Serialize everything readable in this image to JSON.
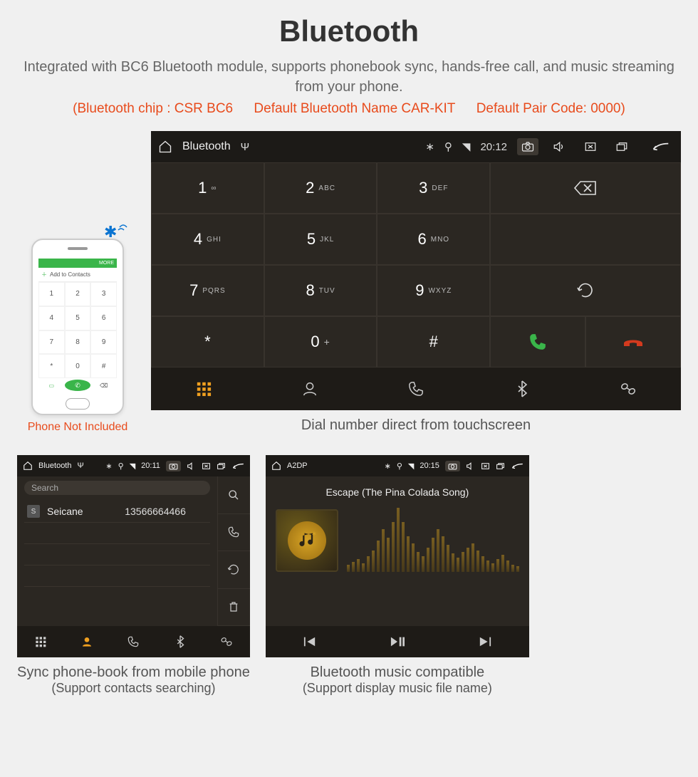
{
  "header": {
    "title": "Bluetooth",
    "description": "Integrated with BC6 Bluetooth module, supports phonebook sync, hands-free call, and music streaming from your phone.",
    "spec_chip": "(Bluetooth chip : CSR BC6",
    "spec_name": "Default Bluetooth Name CAR-KIT",
    "spec_pair": "Default Pair Code: 0000)"
  },
  "phone": {
    "top_more": "MORE",
    "add_contacts": "Add to Contacts",
    "keys": [
      "1",
      "2",
      "3",
      "4",
      "5",
      "6",
      "7",
      "8",
      "9",
      "*",
      "0",
      "#"
    ],
    "note": "Phone Not Included"
  },
  "dialer": {
    "status": {
      "title": "Bluetooth",
      "time": "20:12"
    },
    "keys": [
      {
        "digit": "1",
        "sub": "∞"
      },
      {
        "digit": "2",
        "sub": "ABC"
      },
      {
        "digit": "3",
        "sub": "DEF"
      },
      {
        "digit": "4",
        "sub": "GHI"
      },
      {
        "digit": "5",
        "sub": "JKL"
      },
      {
        "digit": "6",
        "sub": "MNO"
      },
      {
        "digit": "7",
        "sub": "PQRS"
      },
      {
        "digit": "8",
        "sub": "TUV"
      },
      {
        "digit": "9",
        "sub": "WXYZ"
      },
      {
        "digit": "*",
        "sub": ""
      },
      {
        "digit": "0",
        "sub": "+"
      },
      {
        "digit": "#",
        "sub": ""
      }
    ],
    "caption": "Dial number direct from touchscreen"
  },
  "contacts": {
    "status": {
      "title": "Bluetooth",
      "time": "20:11"
    },
    "search_placeholder": "Search",
    "contact": {
      "badge": "S",
      "name": "Seicane",
      "number": "13566664466"
    },
    "caption_line1": "Sync phone-book from mobile phone",
    "caption_line2": "(Support contacts searching)"
  },
  "music": {
    "status": {
      "title": "A2DP",
      "time": "20:15"
    },
    "song": "Escape (The Pina Colada Song)",
    "caption_line1": "Bluetooth music compatible",
    "caption_line2": "(Support display music file name)"
  },
  "colors": {
    "accent_orange": "#e84b1c",
    "accent_gold": "#f0a020",
    "call_green": "#3ab54a",
    "hangup_red": "#d33a1e"
  }
}
